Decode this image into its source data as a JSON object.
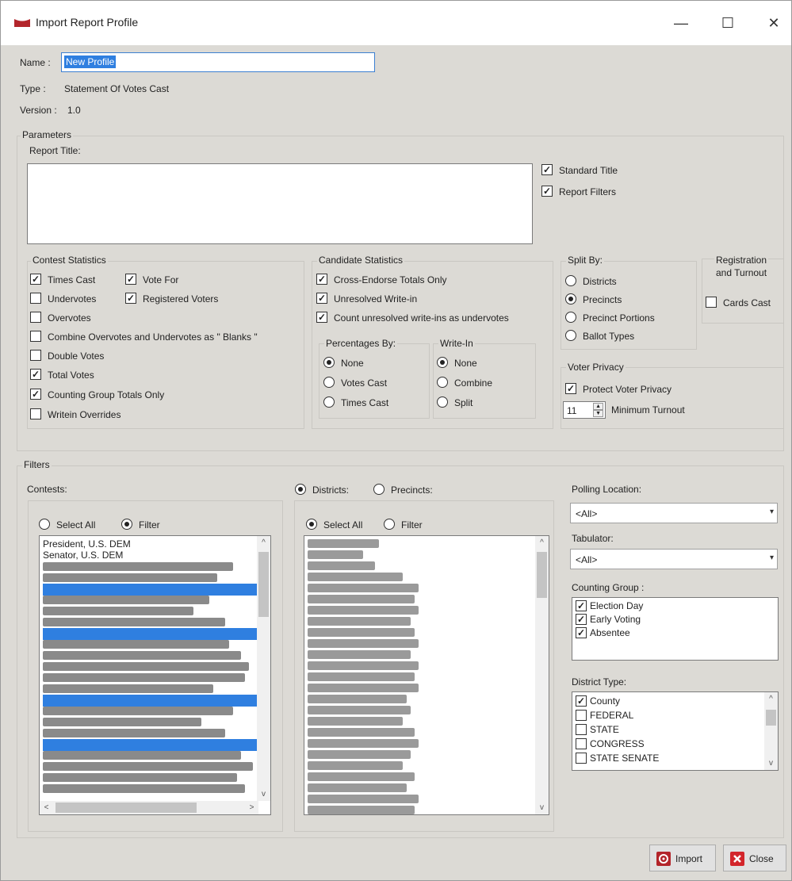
{
  "window": {
    "title": "Import Report Profile",
    "minimize": "—",
    "maximize": "☐",
    "close": "✕"
  },
  "accent_colors": {
    "selection": "#2f7fe0",
    "import_icon": "#b3252b",
    "close_icon": "#d3252b"
  },
  "header": {
    "name_label": "Name :",
    "name_value": "New Profile",
    "type_label": "Type :",
    "type_value": "Statement Of Votes Cast",
    "version_label": "Version :",
    "version_value": "1.0"
  },
  "parameters": {
    "group_label": "Parameters",
    "report_title_label": "Report Title:",
    "report_title_value": "",
    "standard_title": {
      "label": "Standard Title",
      "checked": true
    },
    "report_filters": {
      "label": "Report Filters",
      "checked": true
    }
  },
  "contest_statistics": {
    "label": "Contest Statistics",
    "times_cast": "Times Cast",
    "vote_for": "Vote For",
    "undervotes": "Undervotes",
    "registered_voters": "Registered Voters",
    "overvotes": "Overvotes",
    "combine": "Combine Overvotes and Undervotes as \" Blanks \"",
    "double_votes": "Double Votes",
    "total_votes": "Total Votes",
    "counting_group_totals": "Counting Group Totals Only",
    "writein_overrides": "Writein Overrides"
  },
  "candidate_statistics": {
    "label": "Candidate Statistics",
    "cross_endorse": "Cross-Endorse Totals Only",
    "unresolved_writein": "Unresolved Write-in",
    "count_unresolved": "Count unresolved write-ins as undervotes",
    "percentages_label": "Percentages By:",
    "pct_none": "None",
    "pct_votes_cast": "Votes Cast",
    "pct_times_cast": "Times Cast",
    "writein_label": "Write-In",
    "wi_none": "None",
    "wi_combine": "Combine",
    "wi_split": "Split"
  },
  "split_by": {
    "label": "Split By:",
    "districts": "Districts",
    "precincts": "Precincts",
    "precinct_portions": "Precinct Portions",
    "ballot_types": "Ballot Types"
  },
  "registration": {
    "label_line1": "Registration",
    "label_line2": "and Turnout",
    "cards_cast": "Cards Cast"
  },
  "voter_privacy": {
    "label": "Voter Privacy",
    "protect": "Protect Voter Privacy",
    "min_value": "11",
    "min_label": "Minimum Turnout"
  },
  "filters": {
    "group_label": "Filters",
    "contests_label": "Contests:",
    "select_all": "Select All",
    "filter": "Filter",
    "contest_items": [
      "President, U.S. DEM",
      "Senator, U.S. DEM"
    ],
    "districts_radio": "Districts:",
    "precincts_radio": "Precincts:",
    "select_all_2": "Select All",
    "filter_2": "Filter",
    "polling_location_label": "Polling Location:",
    "polling_location_value": "<All>",
    "tabulator_label": "Tabulator:",
    "tabulator_value": "<All>",
    "counting_group_label": "Counting Group :",
    "counting_groups": [
      "Election Day",
      "Early Voting",
      "Absentee"
    ],
    "district_type_label": "District Type:",
    "district_types": [
      "County",
      "FEDERAL",
      "STATE",
      "CONGRESS",
      "STATE SENATE"
    ]
  },
  "buttons": {
    "import": "Import",
    "close": "Close"
  },
  "glyphs": {
    "check": "✓",
    "up": "^",
    "down": "v",
    "left": "<",
    "right": ">",
    "dd": "▾",
    "spin_up": "▲",
    "spin_down": "▼"
  }
}
